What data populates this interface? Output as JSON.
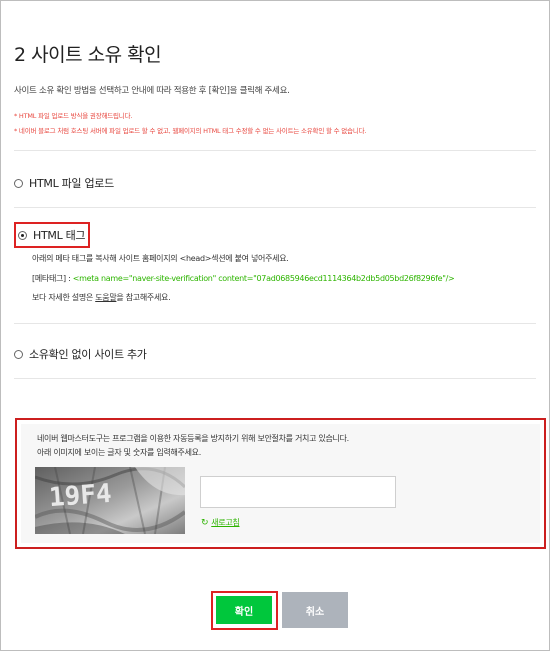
{
  "page": {
    "title": "2 사이트 소유 확인",
    "intro": "사이트 소유 확인 방법을 선택하고 안내에 따라 적용한 후 [확인]을 클릭해 주세요.",
    "notes": [
      "* HTML 파일 업로드 방식을 권장해드립니다.",
      "* 네이버 블로그 처럼 호스팅 서버에 파일 업로드 할 수 없고, 웹페이지의 HTML 태그 수정할 수 없는 사이트는 소유확인 할 수 없습니다."
    ]
  },
  "options": {
    "html_file_upload": {
      "label": "HTML 파일 업로드",
      "checked": false
    },
    "html_tag": {
      "label": "HTML 태그",
      "checked": true,
      "detail_line1": "아래의 메타 태그를 복사해 사이트 홈페이지의 <head>섹션에 붙여 넣어주세요.",
      "meta_label": "[메타태그] : ",
      "meta_code": "<meta name=\"naver-site-verification\" content=\"07ad0685946ecd1114364b2db5d05bd26f8296fe\"/>",
      "detail_prefix": "보다 자세한 설명은 ",
      "help_link": "도움말",
      "detail_suffix": "을 참고해주세요."
    },
    "no_verification": {
      "label": "소유확인 없이 사이트 추가",
      "checked": false
    }
  },
  "captcha": {
    "line1": "네이버 웹마스터도구는 프로그램을 이용한 자동등록을 방지하기 위해 보안절차를 거치고 있습니다.",
    "line2": "아래 이미지에 보이는 글자 및 숫자를 입력해주세요.",
    "image_text": "19F4",
    "input_value": "",
    "input_placeholder": "",
    "refresh_label": "새로고침"
  },
  "buttons": {
    "confirm": "확인",
    "cancel": "취소"
  },
  "colors": {
    "accent_green": "#00c73c",
    "link_green": "#2db400",
    "note_red": "#e8473f",
    "highlight_red": "#dd2222",
    "cancel_gray": "#adb3bb"
  }
}
